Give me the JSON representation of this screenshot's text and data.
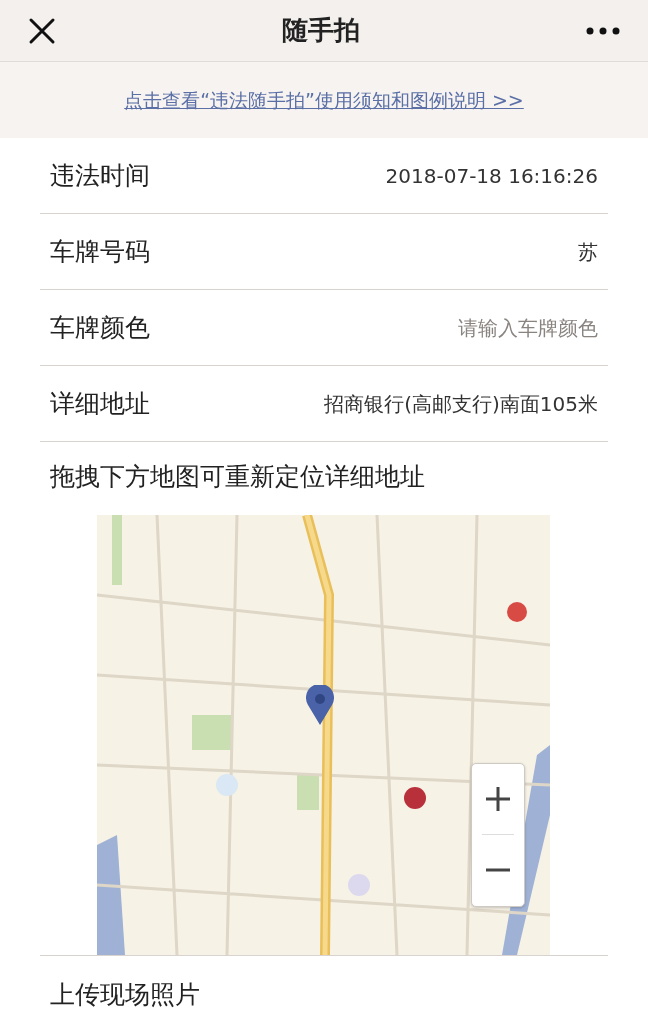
{
  "header": {
    "title": "随手拍"
  },
  "notice_link": "点击查看“违法随手拍”使用须知和图例说明 >>",
  "fields": [
    {
      "label": "违法时间",
      "kind": "value",
      "value": "2018-07-18 16:16:26"
    },
    {
      "label": "车牌号码",
      "kind": "value",
      "value": "苏"
    },
    {
      "label": "车牌颜色",
      "kind": "input",
      "placeholder": "请输入车牌颜色"
    },
    {
      "label": "详细地址",
      "kind": "value",
      "value": "招商银行(高邮支行)南面105米"
    }
  ],
  "map_hint": "拖拽下方地图可重新定位详细地址",
  "upload_label": "上传现场照片"
}
